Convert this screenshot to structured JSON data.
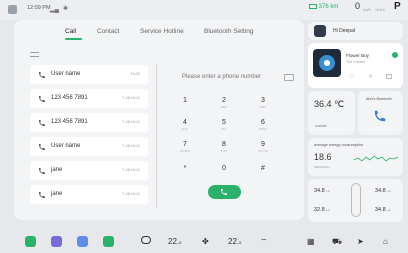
{
  "status_bar": {
    "time": "12:09 PM",
    "range": "376 km",
    "speed_value": "0",
    "speed_unit": "km/h",
    "speed_extra": "16 km",
    "gear": "P"
  },
  "tabs": [
    {
      "label": "Call",
      "active": true
    },
    {
      "label": "Contact",
      "active": false
    },
    {
      "label": "Service Hotline",
      "active": false
    },
    {
      "label": "Bluetooth Setting",
      "active": false
    }
  ],
  "call_log": [
    {
      "name": "User name",
      "time": "15:03"
    },
    {
      "name": "123 456 7891",
      "time": "7-28 15:11"
    },
    {
      "name": "123 456 7891",
      "time": "7-28 15:11"
    },
    {
      "name": "User name",
      "time": "7-28 15:11"
    },
    {
      "name": "jane",
      "time": "7-28 15:11"
    },
    {
      "name": "jane",
      "time": "7-28 15:11"
    }
  ],
  "dialer": {
    "placeholder": "Please enter a phone number",
    "keys": [
      {
        "digit": "1",
        "letters": ""
      },
      {
        "digit": "2",
        "letters": "ABC"
      },
      {
        "digit": "3",
        "letters": "DEF"
      },
      {
        "digit": "4",
        "letters": "GHI"
      },
      {
        "digit": "5",
        "letters": "JKL"
      },
      {
        "digit": "6",
        "letters": "MNO"
      },
      {
        "digit": "7",
        "letters": "PQRS"
      },
      {
        "digit": "8",
        "letters": "TUV"
      },
      {
        "digit": "9",
        "letters": "WXYZ"
      },
      {
        "digit": "*",
        "letters": ""
      },
      {
        "digit": "0",
        "letters": ""
      },
      {
        "digit": "#",
        "letters": ""
      }
    ]
  },
  "assistant": {
    "label": "Hi Deepal"
  },
  "music": {
    "title": "Flower Boy",
    "artist": "The Creator"
  },
  "climate": {
    "temperature": "36.4 ℃",
    "location": "outside"
  },
  "bluetooth": {
    "label": "Alex's Bluetooth"
  },
  "energy": {
    "title": "average energy consumption",
    "value": "18.6",
    "unit": "kWh/100km"
  },
  "tires": {
    "front_left": "34.8",
    "front_right": "34.8",
    "rear_left": "32.8",
    "rear_right": "34.8",
    "unit": "psi"
  },
  "dock": {
    "left_temp": "22.",
    "left_unit": "5",
    "right_temp": "22.",
    "right_unit": "5"
  },
  "colors": {
    "accent": "#2ab26a",
    "background": "#e6e8ec",
    "panel": "#f3f4f6"
  }
}
